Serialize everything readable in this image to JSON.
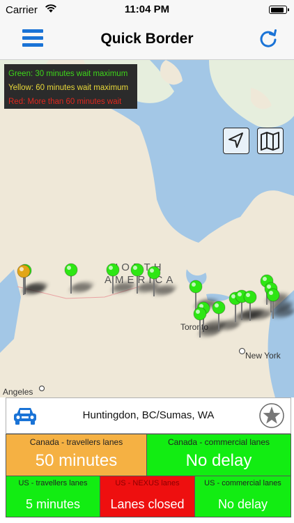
{
  "status_bar": {
    "carrier": "Carrier",
    "time": "11:04 PM",
    "battery_level": 0.9
  },
  "nav": {
    "title": "Quick Border",
    "menu_icon": "hamburger-menu-icon",
    "refresh_icon": "refresh-icon"
  },
  "legend": {
    "green": "Green: 30 minutes wait maximum",
    "yellow": "Yellow: 60 minutes wait maximum",
    "red": "Red: More than 60 minutes wait",
    "colors": {
      "green": "#3ed61a",
      "yellow": "#e8d83a",
      "red": "#e0281e"
    }
  },
  "map": {
    "labels": {
      "continent_line1": "NORTH",
      "continent_line2": "AMERICA",
      "toronto": "Toronto",
      "new_york": "New York",
      "los_angeles": "Angeles"
    },
    "buttons": {
      "locate": "location-arrow-icon",
      "map_type": "map-icon"
    },
    "pin_colors": {
      "green": "#2ee614",
      "yellow": "#e2a516"
    }
  },
  "selected_crossing": {
    "name": "Huntingdon, BC/Sumas, WA",
    "icon": "car-icon",
    "favorite_icon": "star-icon"
  },
  "wait_times": {
    "canada": [
      {
        "label": "Canada - travellers lanes",
        "value": "50 minutes",
        "color": "#f5b143"
      },
      {
        "label": "Canada - commercial lanes",
        "value": "No delay",
        "color": "#12ed12"
      }
    ],
    "us": [
      {
        "label": "US - travellers lanes",
        "value": "5 minutes",
        "color": "#12ed12"
      },
      {
        "label": "US - NEXUS lanes",
        "value": "Lanes closed",
        "color": "#ee0f0f"
      },
      {
        "label": "US - commercial lanes",
        "value": "No delay",
        "color": "#12ed12"
      }
    ]
  }
}
